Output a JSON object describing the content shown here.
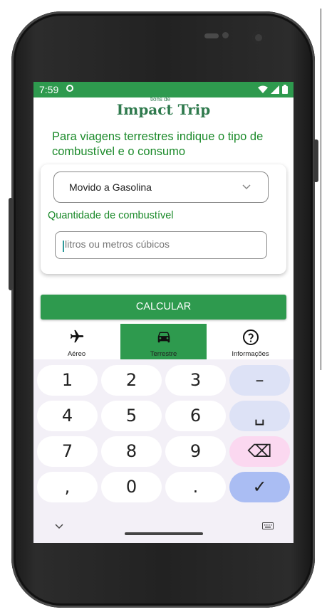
{
  "status_bar": {
    "time": "7:59"
  },
  "header": {
    "logo_small": "tions de",
    "logo": "Impact Trip"
  },
  "main": {
    "instruction": "Para viagens terrestres indique o tipo de combustível e o consumo",
    "fuel_select": {
      "value": "Movido a Gasolina"
    },
    "quantity_label": "Quantidade de combustível",
    "quantity_input": {
      "value": "",
      "placeholder": "litros ou metros cúbicos"
    },
    "calculate_label": "CALCULAR"
  },
  "bottom_nav": {
    "items": [
      {
        "label": "Aéreo",
        "icon": "airplane-icon",
        "active": false
      },
      {
        "label": "Terrestre",
        "icon": "car-icon",
        "active": true
      },
      {
        "label": "Informações",
        "icon": "help-icon",
        "active": false
      }
    ]
  },
  "keyboard": {
    "rows": [
      [
        "1",
        "2",
        "3",
        "–"
      ],
      [
        "4",
        "5",
        "6",
        "␣"
      ],
      [
        "7",
        "8",
        "9",
        "⌫"
      ],
      [
        ",",
        "0",
        ".",
        "✓"
      ]
    ]
  },
  "colors": {
    "primary": "#2e9a4e",
    "text_green": "#1b8a2a",
    "logo": "#2f7a4d"
  }
}
